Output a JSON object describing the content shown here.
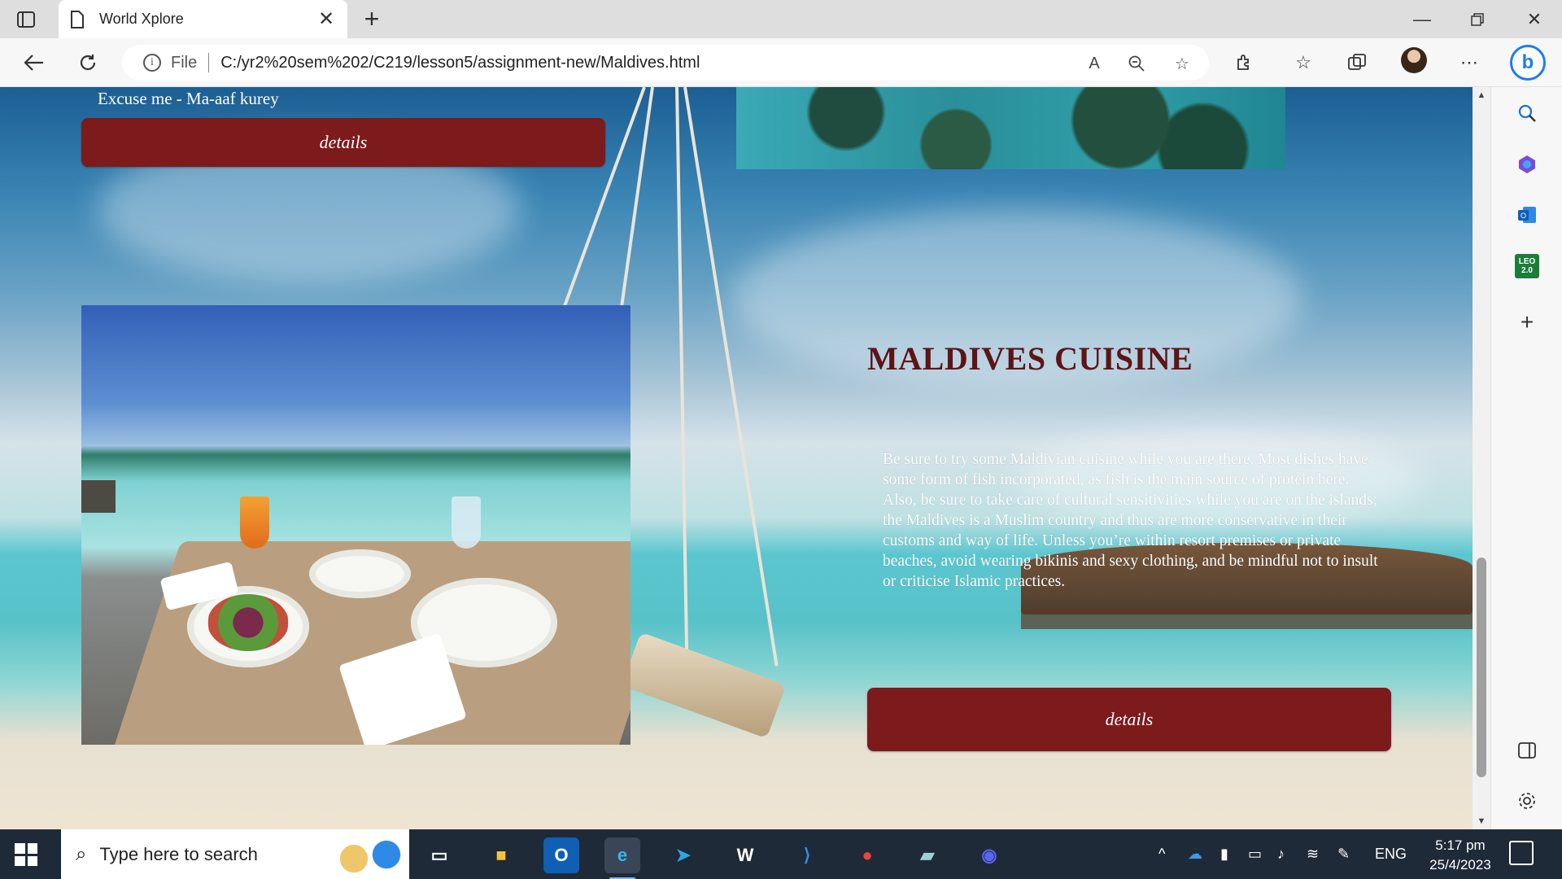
{
  "browser": {
    "tab_title": "World Xplore",
    "file_label": "File",
    "url": "C:/yr2%20sem%202/C219/lesson5/assignment-new/Maldives.html"
  },
  "page": {
    "phrase_line": "Excuse me - Ma-aaf kurey",
    "top_details_label": "details",
    "cuisine_title": "MALDIVES CUISINE",
    "cuisine_text": "Be sure to try some Maldivian cuisine while you are there. Most dishes have some form of fish incorporated, as fish is the main source of protein here. Also, be sure to take care of cultural sensitivities while you are on the islands; the Maldives is a Muslim country and thus are more conservative in their customs and way of life. Unless you’re within resort premises or private beaches, avoid wearing bikinis and sexy clothing, and be mindful not to insult or criticise Islamic practices.",
    "cuisine_details_label": "details"
  },
  "edge_sidebar": {
    "leo_label": "LEO 2.0"
  },
  "taskbar": {
    "search_placeholder": "Type here to search",
    "language": "ENG",
    "time": "5:17 pm",
    "date": "25/4/2023"
  },
  "colors": {
    "button_bg": "#7d1a1c",
    "title_color": "#5e1416",
    "taskbar_bg": "#1f2a38"
  }
}
